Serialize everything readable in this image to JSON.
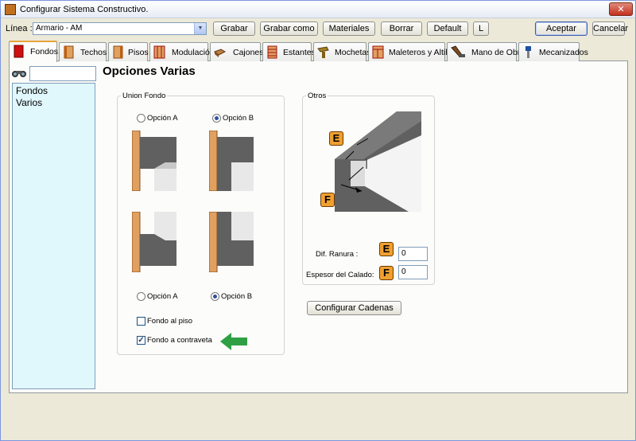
{
  "window": {
    "title": "Configurar Sistema Constructivo."
  },
  "toolbar": {
    "linea_label": "Línea :",
    "linea_value": "Armario - AM",
    "grabar": "Grabar",
    "grabar_como": "Grabar como",
    "materiales": "Materiales",
    "borrar": "Borrar",
    "default": "Default",
    "l": "L",
    "aceptar": "Aceptar",
    "cancelar": "Cancelar"
  },
  "tabs": [
    "Fondos",
    "Techos",
    "Pisos",
    "Modulación",
    "Cajones",
    "Estantes",
    "Mochetas",
    "Maleteros y Altillos",
    "Mano de Obra",
    "Mecanizados"
  ],
  "sidebar": {
    "items": [
      "Fondos",
      "Varios"
    ],
    "search_value": ""
  },
  "main": {
    "heading": "Opciones Varias",
    "union_fondo": {
      "label": "Union Fondo",
      "top_option_a": "Opción A",
      "top_option_b": "Opción B",
      "bottom_option_a": "Opción A",
      "bottom_option_b": "Opción B",
      "fondo_al_piso": "Fondo al piso",
      "fondo_contraveta": "Fondo a contraveta"
    },
    "otros": {
      "label": "Otros",
      "dif_ranura_label": "Dif. Ranura :",
      "dif_ranura_value": "0",
      "espesor_label": "Espesor del Calado:",
      "espesor_value": "0",
      "mark_e": "E",
      "mark_f": "F"
    },
    "configurar_cadenas": "Configurar Cadenas"
  },
  "colors": {
    "accent_arrow": "#2ea043",
    "list_bg": "#e0f7fc",
    "mark": "#f0a030"
  }
}
